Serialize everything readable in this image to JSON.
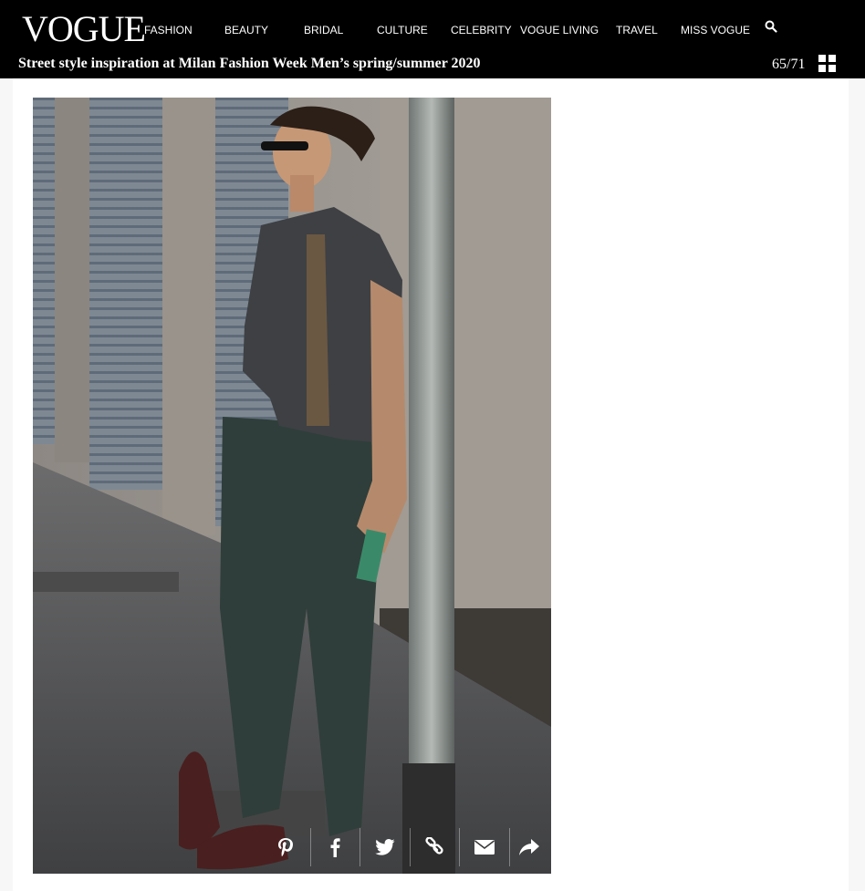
{
  "header": {
    "logo": "VOGUE",
    "nav": [
      {
        "label": "FASHION"
      },
      {
        "label": "BEAUTY"
      },
      {
        "label": "BRIDAL"
      },
      {
        "label": "CULTURE"
      },
      {
        "label": "CELEBRITY"
      },
      {
        "label": "VOGUE LIVING"
      },
      {
        "label": "TRAVEL"
      },
      {
        "label": "MISS VOGUE"
      }
    ],
    "search_icon": "search-icon"
  },
  "gallery": {
    "title": "Street style inspiration at Milan Fashion Week Men’s spring/summer 2020",
    "counter": "65/71",
    "grid_icon": "grid-icon"
  },
  "share": {
    "icons": [
      "pinterest-icon",
      "facebook-icon",
      "twitter-icon",
      "link-icon",
      "email-icon",
      "share-arrow-icon"
    ]
  },
  "colors": {
    "header_bg": "#000000",
    "page_bg": "#f7f7f7",
    "content_bg": "#ffffff"
  }
}
